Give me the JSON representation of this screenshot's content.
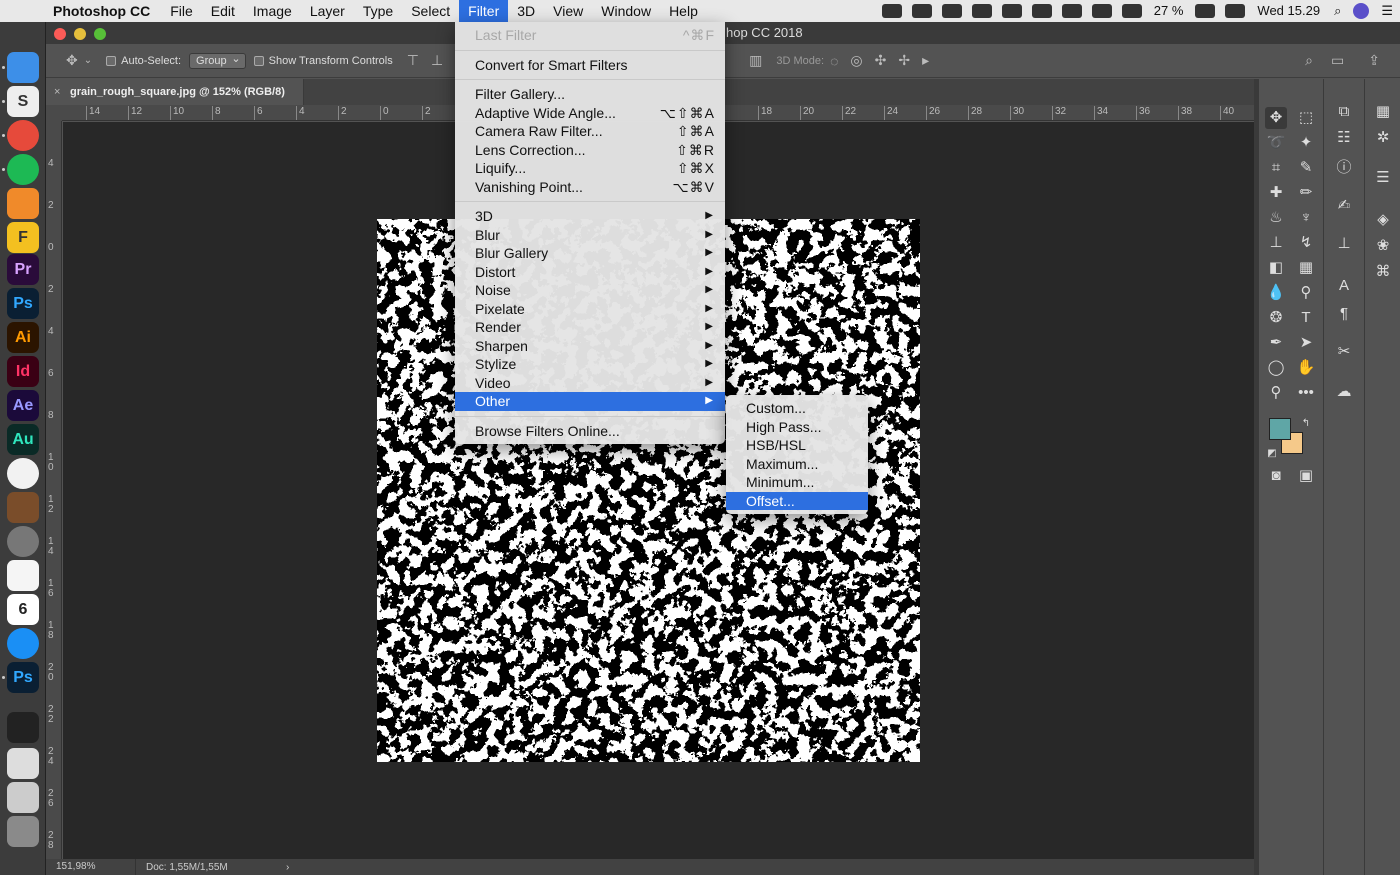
{
  "menubar": {
    "app_name": "Photoshop CC",
    "items": [
      "File",
      "Edit",
      "Image",
      "Layer",
      "Type",
      "Select",
      "Filter",
      "3D",
      "View",
      "Window",
      "Help"
    ],
    "battery": "27 %",
    "clock": "Wed 15.29"
  },
  "window": {
    "title": "hop CC 2018",
    "doc_tab": "grain_rough_square.jpg @ 152% (RGB/8)",
    "doc_tab_close": "×"
  },
  "options": {
    "auto_select_label": "Auto-Select:",
    "auto_select_value": "Group",
    "show_transform_label": "Show Transform Controls",
    "mode_3d_label": "3D Mode:"
  },
  "rulers": {
    "h_labels": [
      "14",
      "12",
      "10",
      "8",
      "6",
      "4",
      "2",
      "0",
      "2",
      "18",
      "20",
      "22",
      "24",
      "26",
      "28",
      "30",
      "32",
      "34",
      "36",
      "38",
      "40"
    ],
    "v_labels": [
      "4",
      "2",
      "0",
      "2",
      "4",
      "6",
      "8",
      "10",
      "12",
      "14",
      "16",
      "18",
      "20",
      "22",
      "24",
      "26",
      "28",
      "3"
    ]
  },
  "status": {
    "zoom": "151,98%",
    "doc": "Doc: 1,55M/1,55M",
    "arrow": "›"
  },
  "filter_menu": {
    "items": [
      {
        "label": "Last Filter",
        "shortcut": "^⌘F",
        "disabled": true
      },
      {
        "sep": true
      },
      {
        "label": "Convert for Smart Filters"
      },
      {
        "sep": true
      },
      {
        "label": "Filter Gallery..."
      },
      {
        "label": "Adaptive Wide Angle...",
        "shortcut": "⌥⇧⌘A"
      },
      {
        "label": "Camera Raw Filter...",
        "shortcut": "⇧⌘A"
      },
      {
        "label": "Lens Correction...",
        "shortcut": "⇧⌘R"
      },
      {
        "label": "Liquify...",
        "shortcut": "⇧⌘X"
      },
      {
        "label": "Vanishing Point...",
        "shortcut": "⌥⌘V"
      },
      {
        "sep": true
      },
      {
        "label": "3D",
        "sub": true
      },
      {
        "label": "Blur",
        "sub": true
      },
      {
        "label": "Blur Gallery",
        "sub": true
      },
      {
        "label": "Distort",
        "sub": true
      },
      {
        "label": "Noise",
        "sub": true
      },
      {
        "label": "Pixelate",
        "sub": true
      },
      {
        "label": "Render",
        "sub": true
      },
      {
        "label": "Sharpen",
        "sub": true
      },
      {
        "label": "Stylize",
        "sub": true
      },
      {
        "label": "Video",
        "sub": true
      },
      {
        "label": "Other",
        "sub": true,
        "highlighted": true
      },
      {
        "sep": true
      },
      {
        "label": "Browse Filters Online..."
      }
    ]
  },
  "other_submenu": {
    "items": [
      {
        "label": "Custom..."
      },
      {
        "label": "High Pass..."
      },
      {
        "label": "HSB/HSL"
      },
      {
        "label": "Maximum..."
      },
      {
        "label": "Minimum..."
      },
      {
        "label": "Offset...",
        "highlighted": true
      }
    ]
  },
  "colors": {
    "foreground": "#5fa6a6",
    "background": "#f5c98a",
    "menu_highlight": "#2d6fe0"
  }
}
